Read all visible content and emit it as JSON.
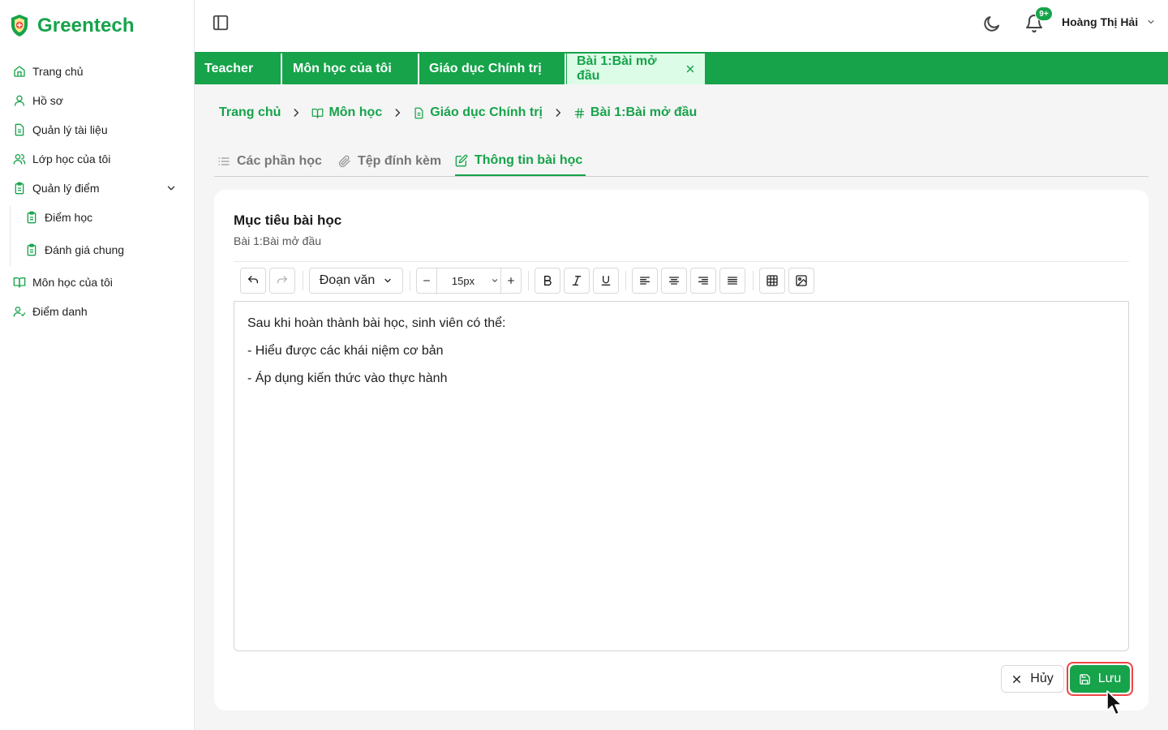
{
  "brand": {
    "name": "Greentech",
    "logo_icon": "shield-logo-icon"
  },
  "colors": {
    "accent": "#16a34a",
    "accent_light": "#dcfce7",
    "highlight": "#ef4444"
  },
  "sidebar": {
    "items": [
      {
        "label": "Trang chủ",
        "icon": "home-icon"
      },
      {
        "label": "Hồ sơ",
        "icon": "user-icon"
      },
      {
        "label": "Quản lý tài liệu",
        "icon": "document-icon"
      },
      {
        "label": "Lớp học của tôi",
        "icon": "users-icon"
      },
      {
        "label": "Quản lý điểm",
        "icon": "clipboard-icon",
        "expanded": true,
        "children": [
          {
            "label": "Điểm học",
            "icon": "clipboard-icon"
          },
          {
            "label": "Đánh giá chung",
            "icon": "clipboard-icon"
          }
        ]
      },
      {
        "label": "Môn học của tôi",
        "icon": "book-icon"
      },
      {
        "label": "Điểm danh",
        "icon": "user-check-icon"
      }
    ]
  },
  "header": {
    "notification_badge": "9+",
    "user_name": "Hoàng Thị Hải"
  },
  "page_tabs": [
    {
      "label": "Teacher"
    },
    {
      "label": "Môn học của tôi"
    },
    {
      "label": "Giáo dục Chính trị"
    },
    {
      "label": "Bài 1:Bài mở đầu",
      "active": true,
      "closable": true
    }
  ],
  "breadcrumb": [
    {
      "label": "Trang chủ"
    },
    {
      "label": "Môn học",
      "icon": "book-open-icon"
    },
    {
      "label": "Giáo dục Chính trị",
      "icon": "file-text-icon"
    },
    {
      "label": "Bài 1:Bài mở đầu",
      "icon": "hash-icon"
    }
  ],
  "content_tabs": [
    {
      "label": "Các phần học",
      "icon": "list-icon"
    },
    {
      "label": "Tệp đính kèm",
      "icon": "paperclip-icon"
    },
    {
      "label": "Thông tin bài học",
      "icon": "edit-icon",
      "active": true
    }
  ],
  "card": {
    "title": "Mục tiêu bài học",
    "subtitle": "Bài 1:Bài mở đầu"
  },
  "toolbar": {
    "block_format": "Đoạn văn",
    "font_size": "15px"
  },
  "editor": {
    "lines": [
      "Sau khi hoàn thành bài học, sinh viên có thể:",
      "- Hiểu được các khái niệm cơ bản",
      "- Áp dụng kiến thức vào thực hành"
    ]
  },
  "actions": {
    "cancel_label": "Hủy",
    "save_label": "Lưu"
  }
}
